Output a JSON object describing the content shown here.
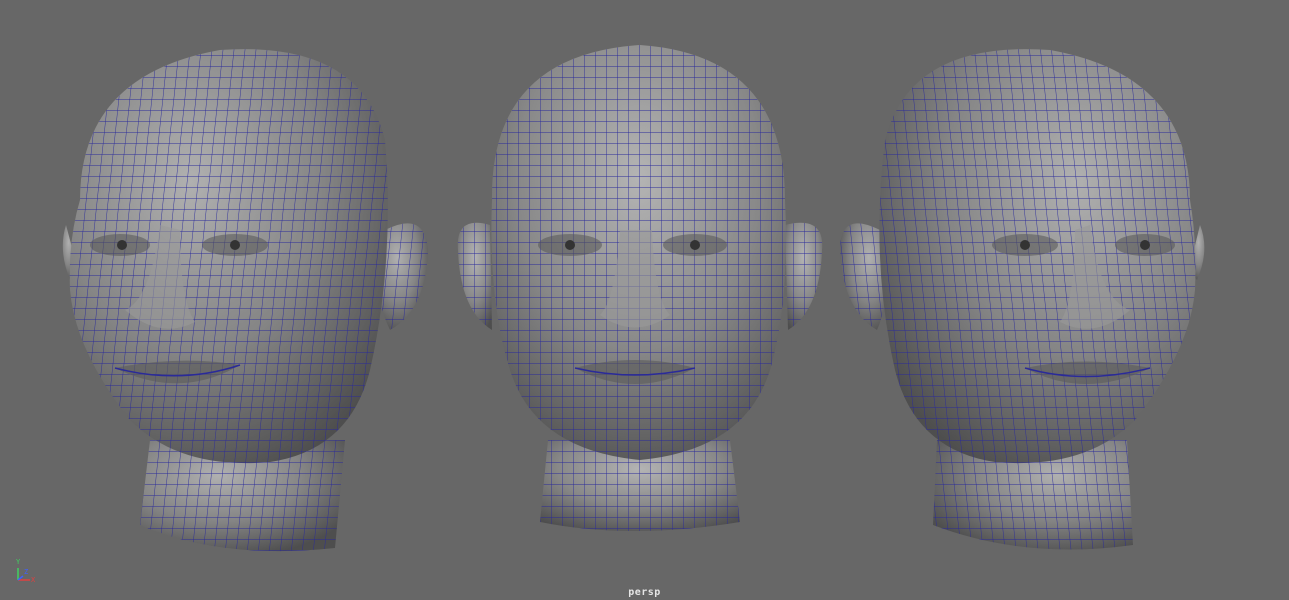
{
  "viewport": {
    "camera_label": "persp",
    "background_color": "#676767",
    "wireframe_color": "#2a2a9a",
    "mesh_shade_color": "#8a8a8a"
  },
  "axis_gizmo": {
    "y_label": "Y",
    "x_label": "X",
    "z_label": "Z",
    "y_color": "#40d060",
    "x_color": "#e04040",
    "z_color": "#4060ff"
  },
  "models": [
    {
      "name": "head-three-quarter-left",
      "view": "three-quarter-left"
    },
    {
      "name": "head-front",
      "view": "front"
    },
    {
      "name": "head-three-quarter-right",
      "view": "three-quarter-right"
    }
  ]
}
